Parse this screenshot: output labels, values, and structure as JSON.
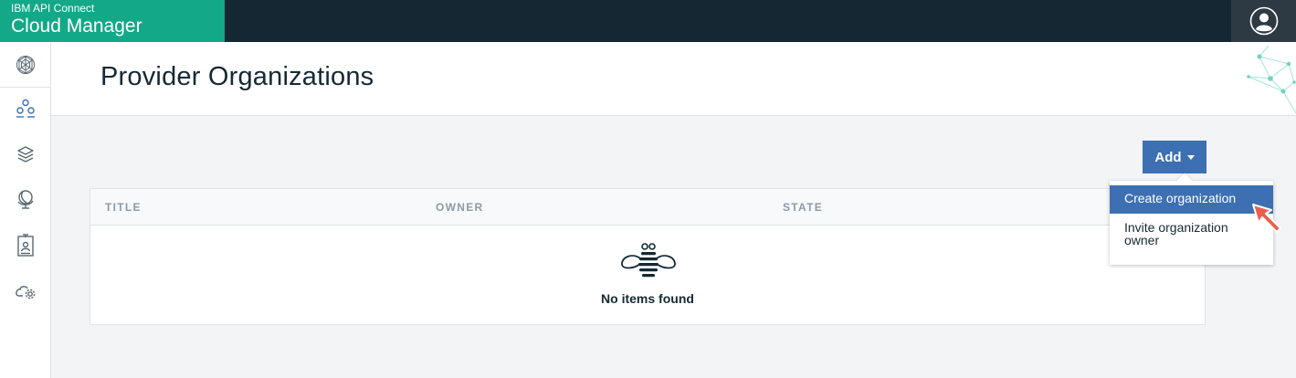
{
  "header": {
    "product_line": "IBM API Connect",
    "product_name": "Cloud Manager",
    "user_icon": "user-avatar-icon"
  },
  "sidebar": {
    "items": [
      {
        "icon": "network-globe-icon"
      },
      {
        "icon": "organizations-icon",
        "active": true
      },
      {
        "icon": "layers-icon"
      },
      {
        "icon": "globe-stand-icon"
      },
      {
        "icon": "id-badge-icon"
      },
      {
        "icon": "cloud-settings-icon"
      }
    ]
  },
  "page": {
    "title": "Provider Organizations"
  },
  "toolbar": {
    "add_label": "Add"
  },
  "table": {
    "columns": [
      "TITLE",
      "OWNER",
      "STATE"
    ],
    "empty_icon": "bee-icon",
    "empty_message": "No items found"
  },
  "add_menu": {
    "items": [
      {
        "label": "Create organization",
        "highlighted": true
      },
      {
        "label": "Invite organization owner",
        "highlighted": false
      }
    ]
  },
  "colors": {
    "brand": "#13a887",
    "topbar": "#152733",
    "accent": "#3d70b2",
    "pointer": "#e8604c"
  }
}
